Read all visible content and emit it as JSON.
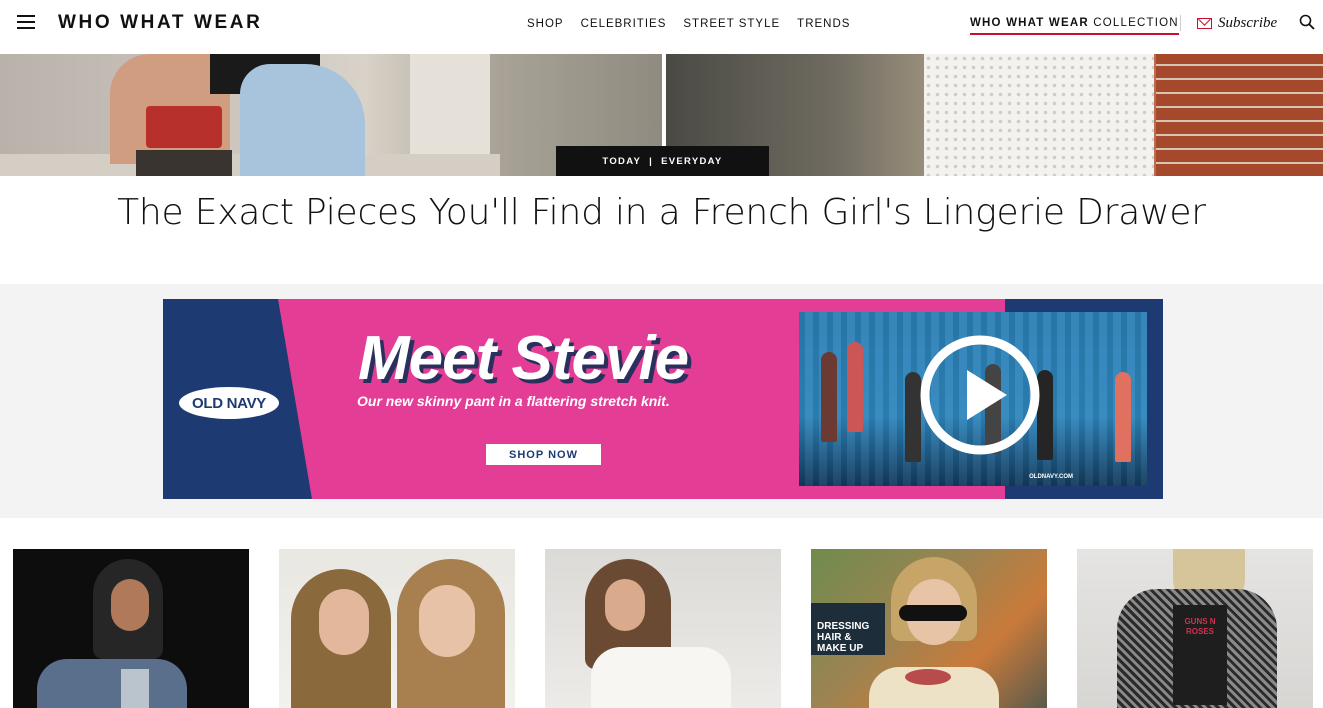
{
  "header": {
    "logo": "WHO WHAT WEAR",
    "nav": [
      "SHOP",
      "CELEBRITIES",
      "STREET STYLE",
      "TRENDS"
    ],
    "collection_bold": "WHO WHAT WEAR",
    "collection_rest": "COLLECTION",
    "subscribe": "Subscribe",
    "accent_color": "#c8102e"
  },
  "hero": {
    "badge_left": "TODAY",
    "badge_sep": "|",
    "badge_right": "EVERYDAY",
    "headline": "The Exact Pieces You'll Find in a French Girl's Lingerie Drawer"
  },
  "ad": {
    "brand": "OLD NAVY",
    "title": "Meet Stevie",
    "subtitle": "Our new skinny pant in a flattering stretch knit.",
    "cta": "SHOP NOW",
    "video_url": "OLDNAVY.COM",
    "colors": {
      "navy": "#1d3a73",
      "pink": "#e43d96"
    }
  },
  "thumbnails": [
    {
      "name": "thumb-1"
    },
    {
      "name": "thumb-2"
    },
    {
      "name": "thumb-3"
    },
    {
      "name": "thumb-4",
      "sign_line1": "DRESSING",
      "sign_line2": "HAIR & MAKE UP"
    },
    {
      "name": "thumb-5",
      "shirt_text": "GUNS N ROSES"
    }
  ]
}
